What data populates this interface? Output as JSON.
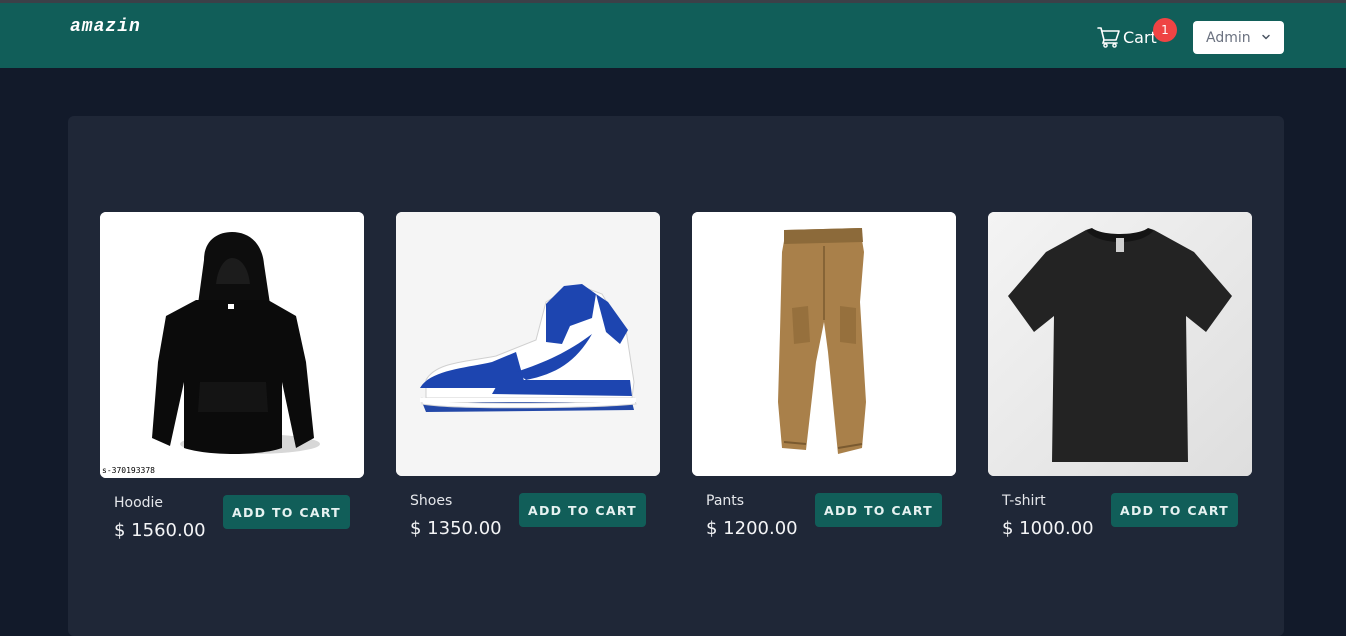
{
  "header": {
    "logo": "amazin",
    "cart_label": "Cart",
    "cart_count": "1",
    "user_menu_label": "Admin"
  },
  "products": [
    {
      "name": "Hoodie",
      "price": "$ 1560.00",
      "button": "ADD TO CART",
      "image_caption": "s-370193378"
    },
    {
      "name": "Shoes",
      "price": "$ 1350.00",
      "button": "ADD TO CART"
    },
    {
      "name": "Pants",
      "price": "$ 1200.00",
      "button": "ADD TO CART"
    },
    {
      "name": "T-shirt",
      "price": "$ 1000.00",
      "button": "ADD TO CART"
    }
  ],
  "colors": {
    "header_bg": "#115e59",
    "page_bg": "#121a2a",
    "panel_bg": "#1f2737",
    "button_bg": "#115e59",
    "badge_bg": "#ef4444"
  },
  "icons": {
    "cart": "shopping-cart-icon",
    "user_menu": "chevron-down-icon"
  }
}
